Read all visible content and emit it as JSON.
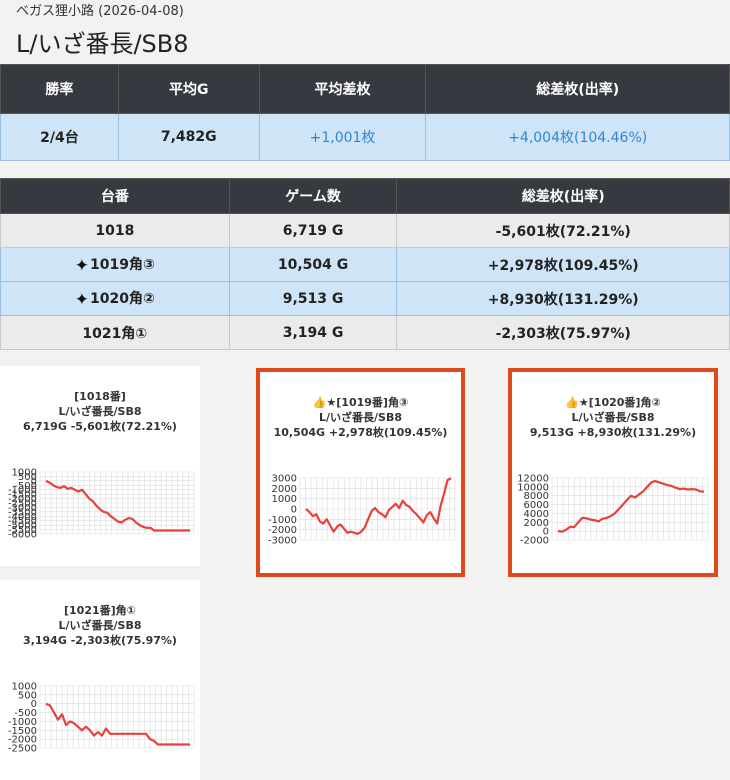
{
  "header": {
    "subtitle": "ベガス狸小路 (2026-04-08)",
    "title": "L/いざ番長/SB8"
  },
  "summary": {
    "headers": [
      "勝率",
      "平均G",
      "平均差枚",
      "総差枚(出率)"
    ],
    "values": [
      "2/4台",
      "7,482G",
      "+1,001枚",
      "+4,004枚(104.46%)"
    ]
  },
  "machines": {
    "headers": [
      "台番",
      "ゲーム数",
      "総差枚(出率)"
    ],
    "rows": [
      {
        "num": "1018",
        "games": "6,719 G",
        "diff": "-5,601枚(72.21%)",
        "highlight": false
      },
      {
        "num": "1019角③",
        "games": "10,504 G",
        "diff": "+2,978枚(109.45%)",
        "highlight": true,
        "icon": "sparkle-icon"
      },
      {
        "num": "1020角②",
        "games": "9,513 G",
        "diff": "+8,930枚(131.29%)",
        "highlight": true,
        "icon": "sparkle-icon"
      },
      {
        "num": "1021角①",
        "games": "3,194 G",
        "diff": "-2,303枚(75.97%)",
        "highlight": false
      }
    ]
  },
  "colors": {
    "header_bg": "#363a40",
    "highlight_row": "#cfe5f7",
    "positive": "#2e86d6",
    "line": "#e8413d",
    "card_border": "#e04a1b"
  },
  "chart_data": [
    {
      "type": "line",
      "title_lines": [
        "[1018番]",
        "L/いざ番長/SB8",
        "6,719G -5,601枚(72.21%)"
      ],
      "yticks": [
        1000,
        500,
        0,
        -500,
        -1000,
        -1500,
        -2000,
        -2500,
        -3000,
        -3500,
        -4000,
        -4500,
        -5000,
        -5500,
        -6000
      ],
      "ylim": [
        -6000,
        1000
      ],
      "values": [
        0,
        -200,
        -500,
        -700,
        -800,
        -600,
        -900,
        -800,
        -1000,
        -1200,
        -1000,
        -1500,
        -2000,
        -2300,
        -2800,
        -3200,
        -3500,
        -3600,
        -4000,
        -4300,
        -4600,
        -4700,
        -4400,
        -4200,
        -4300,
        -4700,
        -5000,
        -5200,
        -5300,
        -5300,
        -5600,
        -5600,
        -5600,
        -5600,
        -5600,
        -5600,
        -5600,
        -5600,
        -5600,
        -5600,
        -5601
      ],
      "highlight": false
    },
    {
      "type": "line",
      "title_lines": [
        "👍★[1019番]角③",
        "L/いざ番長/SB8",
        "10,504G +2,978枚(109.45%)"
      ],
      "yticks": [
        3000,
        2000,
        1000,
        0,
        -1000,
        -2000,
        -3000
      ],
      "ylim": [
        -3000,
        3000
      ],
      "values": [
        0,
        -300,
        -700,
        -500,
        -1200,
        -1400,
        -1000,
        -1600,
        -2200,
        -1700,
        -1500,
        -1900,
        -2300,
        -2200,
        -2300,
        -2400,
        -2200,
        -1800,
        -1000,
        -200,
        100,
        -300,
        -500,
        -800,
        -100,
        200,
        500,
        100,
        800,
        400,
        200,
        -200,
        -500,
        -900,
        -1300,
        -600,
        -300,
        -900,
        -1400,
        300,
        1500,
        2800,
        2978
      ],
      "highlight": true
    },
    {
      "type": "line",
      "title_lines": [
        "👍★[1020番]角②",
        "L/いざ番長/SB8",
        "9,513G +8,930枚(131.29%)"
      ],
      "yticks": [
        12000,
        10000,
        8000,
        6000,
        4000,
        2000,
        0,
        -2000
      ],
      "ylim": [
        -2000,
        12000
      ],
      "values": [
        0,
        -100,
        300,
        1000,
        900,
        2000,
        3000,
        2900,
        2600,
        2500,
        2200,
        2800,
        3000,
        3400,
        4000,
        5000,
        6000,
        7000,
        8000,
        7600,
        8300,
        9000,
        10000,
        11000,
        11300,
        11000,
        10700,
        10400,
        10200,
        9800,
        9500,
        9600,
        9400,
        9500,
        9400,
        9000,
        8930
      ],
      "highlight": true
    },
    {
      "type": "line",
      "title_lines": [
        "[1021番]角①",
        "L/いざ番長/SB8",
        "3,194G -2,303枚(75.97%)"
      ],
      "yticks": [
        1000,
        500,
        0,
        -500,
        -1000,
        -1500,
        -2000,
        -2500
      ],
      "ylim": [
        -2500,
        1000
      ],
      "values": [
        0,
        -100,
        -500,
        -900,
        -600,
        -1200,
        -1000,
        -1100,
        -1300,
        -1500,
        -1300,
        -1500,
        -1800,
        -1600,
        -1800,
        -1400,
        -1700,
        -1700,
        -1700,
        -1700,
        -1700,
        -1700,
        -1700,
        -1700,
        -1700,
        -1700,
        -2000,
        -2100,
        -2300,
        -2300,
        -2300,
        -2300,
        -2300,
        -2300,
        -2300,
        -2300,
        -2303
      ],
      "highlight": false
    }
  ]
}
